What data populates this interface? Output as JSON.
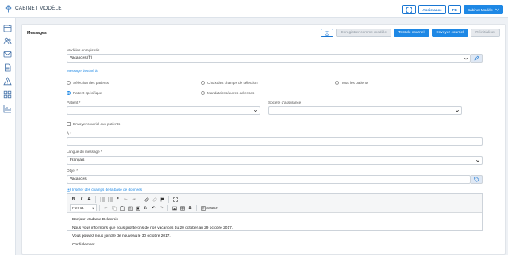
{
  "app": {
    "title": "CABINET MODÈLE"
  },
  "header": {
    "expand_icon": "expand-icon",
    "assistance_label": "Assistance",
    "user_initials": "FB",
    "cabinet_label": "Cabinet Modèle"
  },
  "sidebar": {
    "icons": [
      "calendar-icon",
      "users-icon",
      "mail-icon",
      "document-icon",
      "warning-icon",
      "grid-icon",
      "chart-icon"
    ]
  },
  "messages": {
    "title": "Messages",
    "buttons": {
      "info_icon": "info-icon",
      "save_template": "Enregistrer comme modèle",
      "test_mail": "Test du courriel",
      "send_mail": "Envoyer courriel",
      "reset": "Réinitialiser"
    },
    "saved_templates_label": "Modèles enregistrés",
    "saved_templates_value": "Vacances (fr)",
    "destination_label": "Message destiné à:",
    "destination_options": [
      {
        "label": "Sélection des patients",
        "selected": false
      },
      {
        "label": "Choix des champs de sélection",
        "selected": false
      },
      {
        "label": "Tous les patients",
        "selected": false
      },
      {
        "label": "Patient spécifique",
        "selected": true
      },
      {
        "label": "Mandataires/autres adresses",
        "selected": false
      }
    ],
    "patient_label": "Patient *",
    "patient_value": "",
    "insurance_label": "Société d'assurance",
    "insurance_value": "",
    "send_to_patients_label": "Envoyer courriel aux patients",
    "to_label": "À *",
    "to_value": "",
    "language_label": "Langue du message *",
    "language_value": "Français",
    "subject_label": "Objet *",
    "subject_value": "Vacances",
    "insert_fields_label": "Insérer des champs de la base de données",
    "editor": {
      "format_label": "Format",
      "source_label": "Source",
      "body_lines": [
        "Bonjour Madame Delacroix",
        "Nous vous informons que nous profiterons de nos vacances du 20 october au 29 octobre 2017.",
        "Vous pouvez nous joindre de nouveau le 30 octobre 2017.",
        "Cordialement"
      ]
    }
  }
}
